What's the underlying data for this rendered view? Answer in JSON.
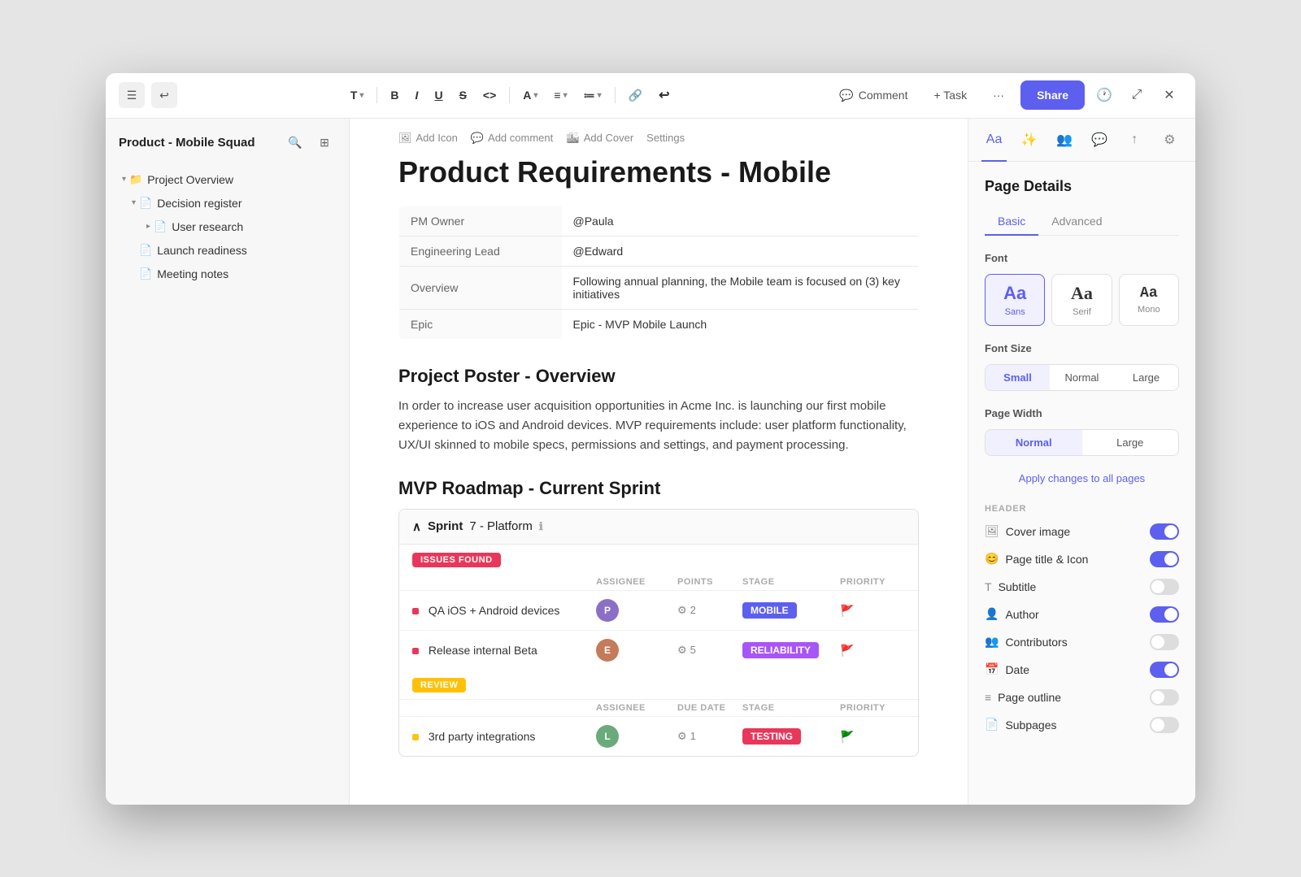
{
  "window": {
    "title": "Product - Mobile Squad"
  },
  "toolbar": {
    "undo_icon": "↩",
    "menu_icon": "☰",
    "text_format": "T",
    "bold": "B",
    "italic": "I",
    "underline": "U",
    "strikethrough": "S",
    "code": "<>",
    "color_a": "A",
    "align": "≡",
    "list": "≔",
    "link": "🔗",
    "mention": "@",
    "comment_label": "Comment",
    "task_label": "+ Task",
    "more": "···",
    "share_label": "Share",
    "history_icon": "🕐",
    "expand_icon": "⤢",
    "close_icon": "✕"
  },
  "sidebar": {
    "title": "Product - Mobile Squad",
    "search_icon": "🔍",
    "layout_icon": "⊞",
    "items": [
      {
        "id": "project-overview",
        "label": "Project Overview",
        "level": 0,
        "expand": true,
        "folder": true
      },
      {
        "id": "decision-register",
        "label": "Decision register",
        "level": 1,
        "expand": true,
        "icon": "doc"
      },
      {
        "id": "user-research",
        "label": "User research",
        "level": 2,
        "expand": false,
        "icon": "doc"
      },
      {
        "id": "launch-readiness",
        "label": "Launch readiness",
        "level": 1,
        "icon": "doc"
      },
      {
        "id": "meeting-notes",
        "label": "Meeting notes",
        "level": 1,
        "icon": "doc"
      }
    ]
  },
  "doc": {
    "action_add_icon": "Add Icon",
    "action_add_comment": "Add comment",
    "action_add_cover": "Add Cover",
    "action_settings": "Settings",
    "title": "Product Requirements - Mobile",
    "table": {
      "rows": [
        {
          "key": "PM Owner",
          "value": "@Paula"
        },
        {
          "key": "Engineering Lead",
          "value": "@Edward"
        },
        {
          "key": "Overview",
          "value": "Following annual planning, the Mobile team is focused on (3) key initiatives"
        },
        {
          "key": "Epic",
          "value": "Epic - MVP Mobile Launch"
        }
      ]
    },
    "section1_heading": "Project Poster - Overview",
    "section1_text": "In order to increase user acquisition opportunities in Acme Inc. is launching our first mobile experience to iOS and Android devices. MVP requirements include: user platform functionality, UX/UI skinned to mobile specs, permissions and settings, and payment processing.",
    "section2_heading": "MVP Roadmap - Current Sprint",
    "sprint": {
      "label": "Sprint",
      "number": "7 - Platform",
      "info_icon": "ℹ",
      "collapse_icon": "∧",
      "issues_badge": "ISSUES FOUND",
      "columns_issues": [
        "ASSIGNEE",
        "POINTS",
        "STAGE",
        "PRIORITY"
      ],
      "tasks_issues": [
        {
          "dot": "red",
          "name": "QA iOS + Android devices",
          "avatar": "1",
          "points": "2",
          "stage": "MOBILE",
          "stage_type": "mobile",
          "priority": "🚩"
        },
        {
          "dot": "red",
          "name": "Release internal Beta",
          "avatar": "2",
          "points": "5",
          "stage": "RELIABILITY",
          "stage_type": "reliability",
          "priority": "🚩"
        }
      ],
      "review_badge": "REVIEW",
      "columns_review": [
        "ASSIGNEE",
        "DUE DATE",
        "STAGE",
        "PRIORITY"
      ],
      "tasks_review": [
        {
          "dot": "yellow",
          "name": "3rd party integrations",
          "avatar": "3",
          "points": "1",
          "stage": "TESTING",
          "stage_type": "testing",
          "priority": "🚩"
        }
      ]
    }
  },
  "right_panel": {
    "tabs": [
      {
        "id": "typography",
        "icon": "Aa",
        "active": true
      },
      {
        "id": "emoji",
        "icon": "✨"
      },
      {
        "id": "people",
        "icon": "👤"
      },
      {
        "id": "search",
        "icon": "💬"
      },
      {
        "id": "export",
        "icon": "↑"
      },
      {
        "id": "settings",
        "icon": "⚙"
      }
    ],
    "section_title": "Page Details",
    "page_tabs": [
      {
        "label": "Basic",
        "active": true
      },
      {
        "label": "Advanced",
        "active": false
      }
    ],
    "font_label": "Font",
    "font_options": [
      {
        "label": "Sans",
        "preview": "Aa",
        "active": true
      },
      {
        "label": "Serif",
        "preview": "Aa",
        "active": false
      },
      {
        "label": "Mono",
        "preview": "Aa",
        "active": false
      }
    ],
    "font_size_label": "Font Size",
    "size_options": [
      {
        "label": "Small",
        "active": true
      },
      {
        "label": "Normal",
        "active": false
      },
      {
        "label": "Large",
        "active": false
      }
    ],
    "page_width_label": "Page Width",
    "width_options": [
      {
        "label": "Normal",
        "active": true
      },
      {
        "label": "Large",
        "active": false
      }
    ],
    "apply_label": "Apply changes to all pages",
    "header_section_label": "HEADER",
    "header_toggles": [
      {
        "id": "cover-image",
        "icon": "🖼",
        "label": "Cover image",
        "on": true
      },
      {
        "id": "page-title-icon",
        "icon": "😊",
        "label": "Page title & Icon",
        "on": true
      },
      {
        "id": "subtitle",
        "icon": "T",
        "label": "Subtitle",
        "on": false
      },
      {
        "id": "author",
        "icon": "👤",
        "label": "Author",
        "on": true
      },
      {
        "id": "contributors",
        "icon": "👥",
        "label": "Contributors",
        "on": false
      },
      {
        "id": "date",
        "icon": "📅",
        "label": "Date",
        "on": true
      },
      {
        "id": "page-outline",
        "icon": "≡",
        "label": "Page outline",
        "on": false
      },
      {
        "id": "subpages",
        "icon": "📄",
        "label": "Subpages",
        "on": false
      }
    ]
  }
}
